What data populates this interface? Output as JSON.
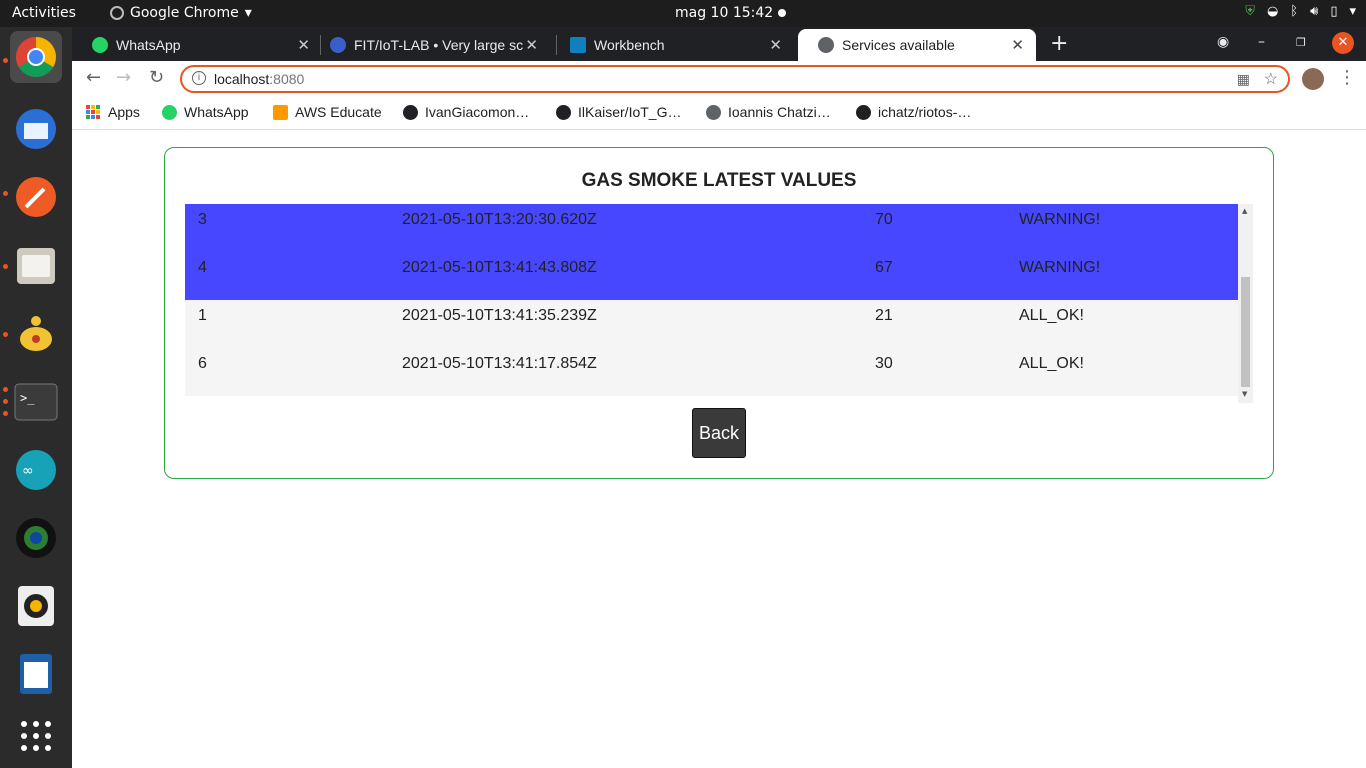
{
  "topbar": {
    "activities": "Activities",
    "app_name": "Google Chrome",
    "clock": "mag 10  15:42"
  },
  "tabs": [
    {
      "label": "WhatsApp",
      "icon": "whatsapp-icon",
      "color": "#25d366"
    },
    {
      "label": "FIT/IoT-LAB • Very large sc",
      "icon": "fit-iotlab-icon",
      "color": "#3a5fc8"
    },
    {
      "label": "Workbench",
      "icon": "workbench-icon",
      "color": "#0f7fbf"
    },
    {
      "label": "Services available",
      "icon": "globe-icon",
      "color": "#5f6368"
    }
  ],
  "address": {
    "host": "localhost",
    "port": ":8080"
  },
  "bookmarks": [
    {
      "label": "Apps",
      "icon": "apps-grid-icon"
    },
    {
      "label": "WhatsApp",
      "icon": "whatsapp-icon"
    },
    {
      "label": "AWS Educate",
      "icon": "aws-icon"
    },
    {
      "label": "IvanGiacomon…",
      "icon": "github-icon"
    },
    {
      "label": "IlKaiser/IoT_G…",
      "icon": "github-icon"
    },
    {
      "label": "Ioannis Chatzi…",
      "icon": "globe-icon"
    },
    {
      "label": "ichatz/riotos-…",
      "icon": "github-icon"
    }
  ],
  "page": {
    "title": "GAS SMOKE LATEST VALUES",
    "back_label": "Back",
    "rows": [
      {
        "id": "3",
        "timestamp": "2021-05-10T13:20:30.620Z",
        "value": "70",
        "status": "WARNING!",
        "level": "warn"
      },
      {
        "id": "4",
        "timestamp": "2021-05-10T13:41:43.808Z",
        "value": "67",
        "status": "WARNING!",
        "level": "warn"
      },
      {
        "id": "1",
        "timestamp": "2021-05-10T13:41:35.239Z",
        "value": "21",
        "status": "ALL_OK!",
        "level": "ok"
      },
      {
        "id": "6",
        "timestamp": "2021-05-10T13:41:17.854Z",
        "value": "30",
        "status": "ALL_OK!",
        "level": "ok"
      }
    ]
  },
  "colors": {
    "warning_row": "#4747ff",
    "ok_row": "#f5f5f5",
    "card_border": "#28a745",
    "ubuntu_orange": "#e95420"
  }
}
